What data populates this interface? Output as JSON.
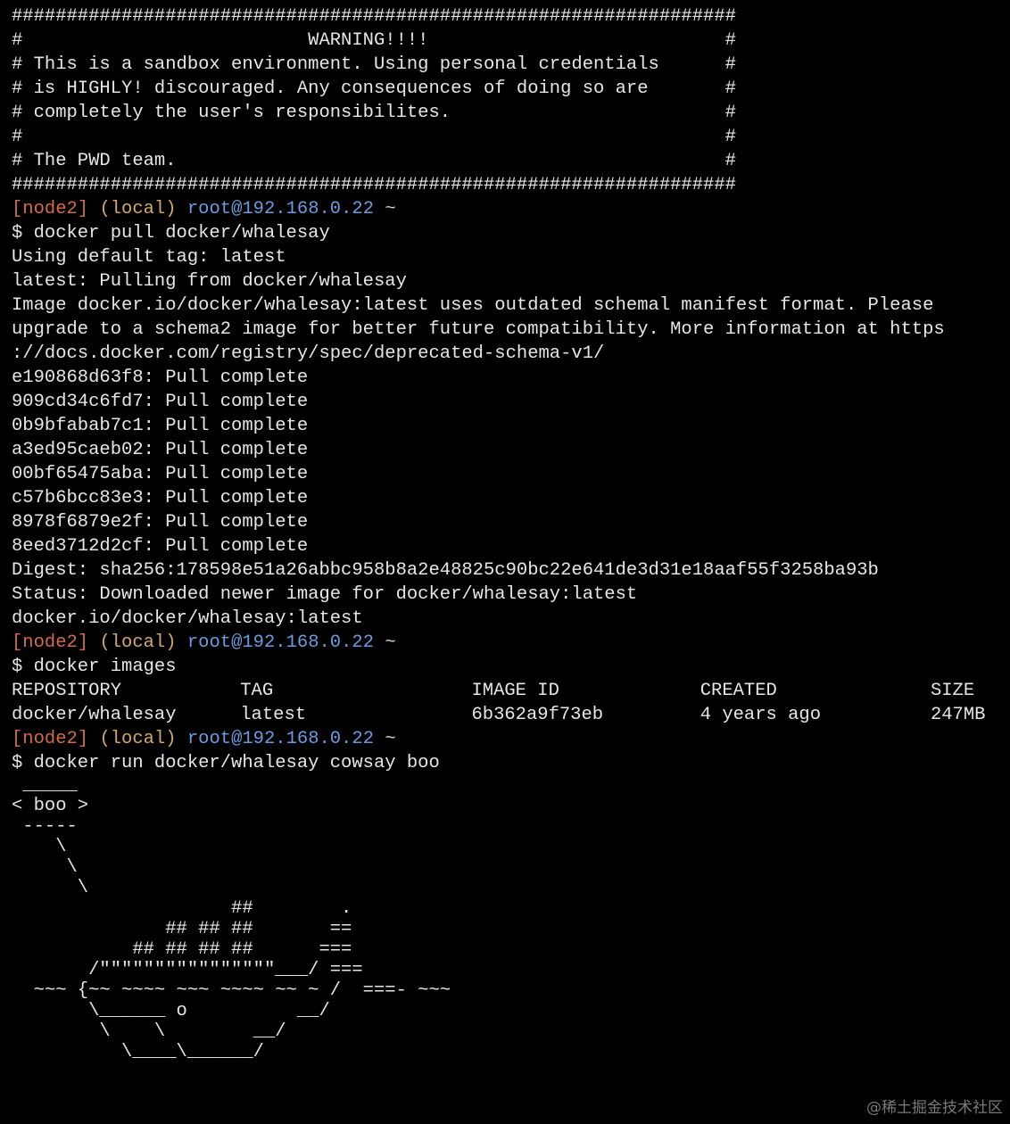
{
  "banner": [
    "##################################################################",
    "#                          WARNING!!!!                           #",
    "# This is a sandbox environment. Using personal credentials      #",
    "# is HIGHLY! discouraged. Any consequences of doing so are       #",
    "# completely the user's responsibilites.                         #",
    "#                                                                #",
    "# The PWD team.                                                  #",
    "##################################################################"
  ],
  "prompt": {
    "node": "[node2]",
    "local": "(local)",
    "user": "root@192.168.0.22",
    "tilde": "~"
  },
  "commands": {
    "pull": "$ docker pull docker/whalesay",
    "images": "$ docker images",
    "run": "$ docker run docker/whalesay cowsay boo"
  },
  "pull_output": [
    "Using default tag: latest",
    "latest: Pulling from docker/whalesay",
    "Image docker.io/docker/whalesay:latest uses outdated schemal manifest format. Please",
    "upgrade to a schema2 image for better future compatibility. More information at https",
    "://docs.docker.com/registry/spec/deprecated-schema-v1/",
    "e190868d63f8: Pull complete",
    "909cd34c6fd7: Pull complete",
    "0b9bfabab7c1: Pull complete",
    "a3ed95caeb02: Pull complete",
    "00bf65475aba: Pull complete",
    "c57b6bcc83e3: Pull complete",
    "8978f6879e2f: Pull complete",
    "8eed3712d2cf: Pull complete",
    "Digest: sha256:178598e51a26abbc958b8a2e48825c90bc22e641de3d31e18aaf55f3258ba93b",
    "Status: Downloaded newer image for docker/whalesay:latest",
    "docker.io/docker/whalesay:latest"
  ],
  "images_table": {
    "headers": [
      "REPOSITORY",
      "TAG",
      "IMAGE ID",
      "CREATED",
      "SIZE"
    ],
    "rows": [
      [
        "docker/whalesay",
        "latest",
        "6b362a9f73eb",
        "4 years ago",
        "247MB"
      ]
    ]
  },
  "whale_art": " _____\n< boo >\n -----\n    \\\n     \\\n      \\\n                    ##        .\n              ## ## ##       ==\n           ## ## ## ##      ===\n       /\"\"\"\"\"\"\"\"\"\"\"\"\"\"\"\"___/ ===\n  ~~~ {~~ ~~~~ ~~~ ~~~~ ~~ ~ /  ===- ~~~\n       \\______ o          __/\n        \\    \\        __/\n          \\____\\______/",
  "watermark": "@稀土掘金技术社区"
}
